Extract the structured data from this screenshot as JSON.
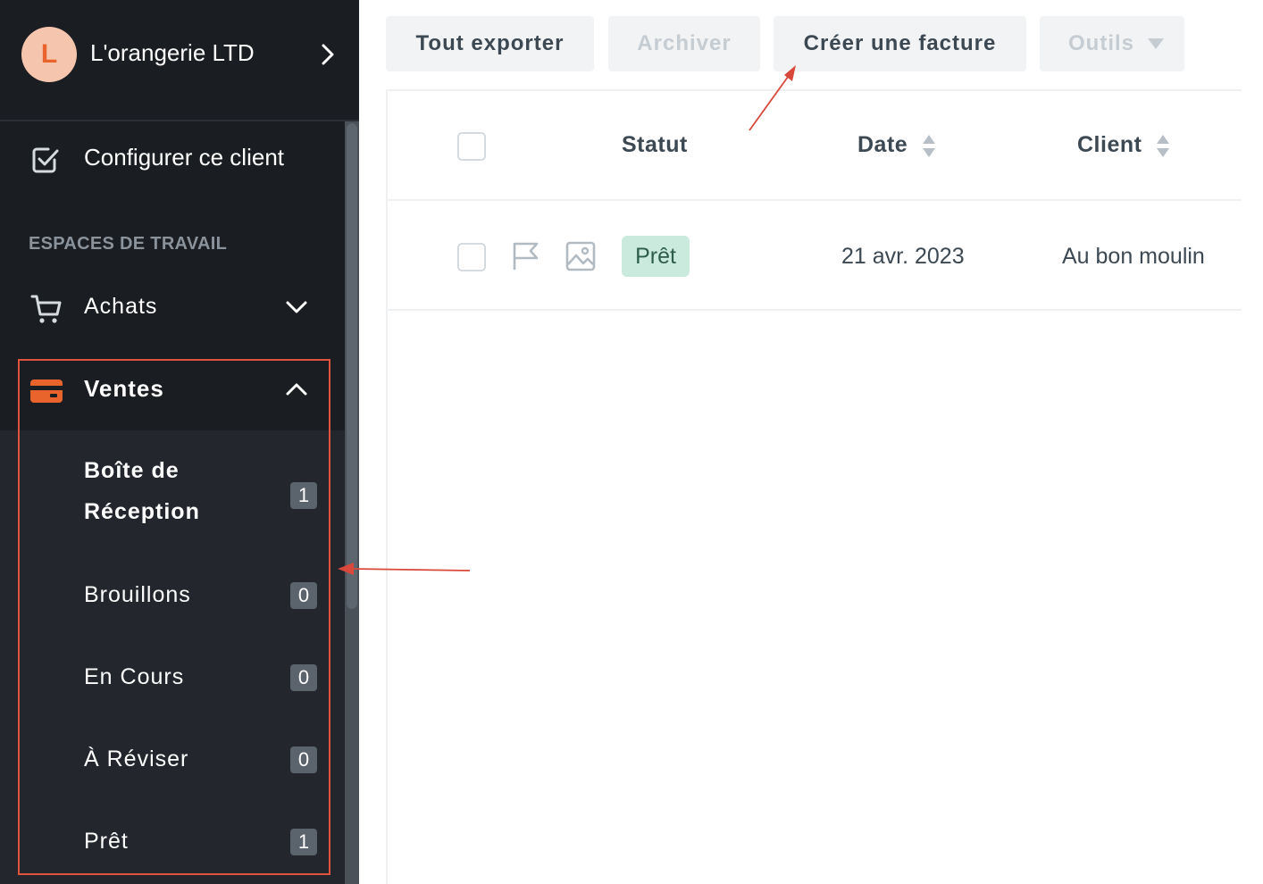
{
  "account": {
    "initial": "L",
    "name": "L'orangerie LTD"
  },
  "sidebar": {
    "configure_label": "Configurer ce client",
    "section_title": "ESPACES DE TRAVAIL",
    "achats_label": "Achats",
    "ventes_label": "Ventes",
    "submenu": [
      {
        "label": "Boîte de Réception",
        "count": "1"
      },
      {
        "label": "Brouillons",
        "count": "0"
      },
      {
        "label": "En Cours",
        "count": "0"
      },
      {
        "label": "À Réviser",
        "count": "0"
      },
      {
        "label": "Prêt",
        "count": "1"
      }
    ]
  },
  "toolbar": {
    "export_label": "Tout exporter",
    "archive_label": "Archiver",
    "create_label": "Créer une facture",
    "tools_label": "Outils"
  },
  "table": {
    "headers": {
      "status": "Statut",
      "date": "Date",
      "client": "Client"
    },
    "rows": [
      {
        "status": "Prêt",
        "date": "21 avr. 2023",
        "client": "Au bon moulin"
      }
    ]
  },
  "colors": {
    "sidebar_bg": "#1a1d21",
    "accent": "#e8642c",
    "annotation": "#e0533d",
    "status_ready_bg": "#c9eadc"
  }
}
